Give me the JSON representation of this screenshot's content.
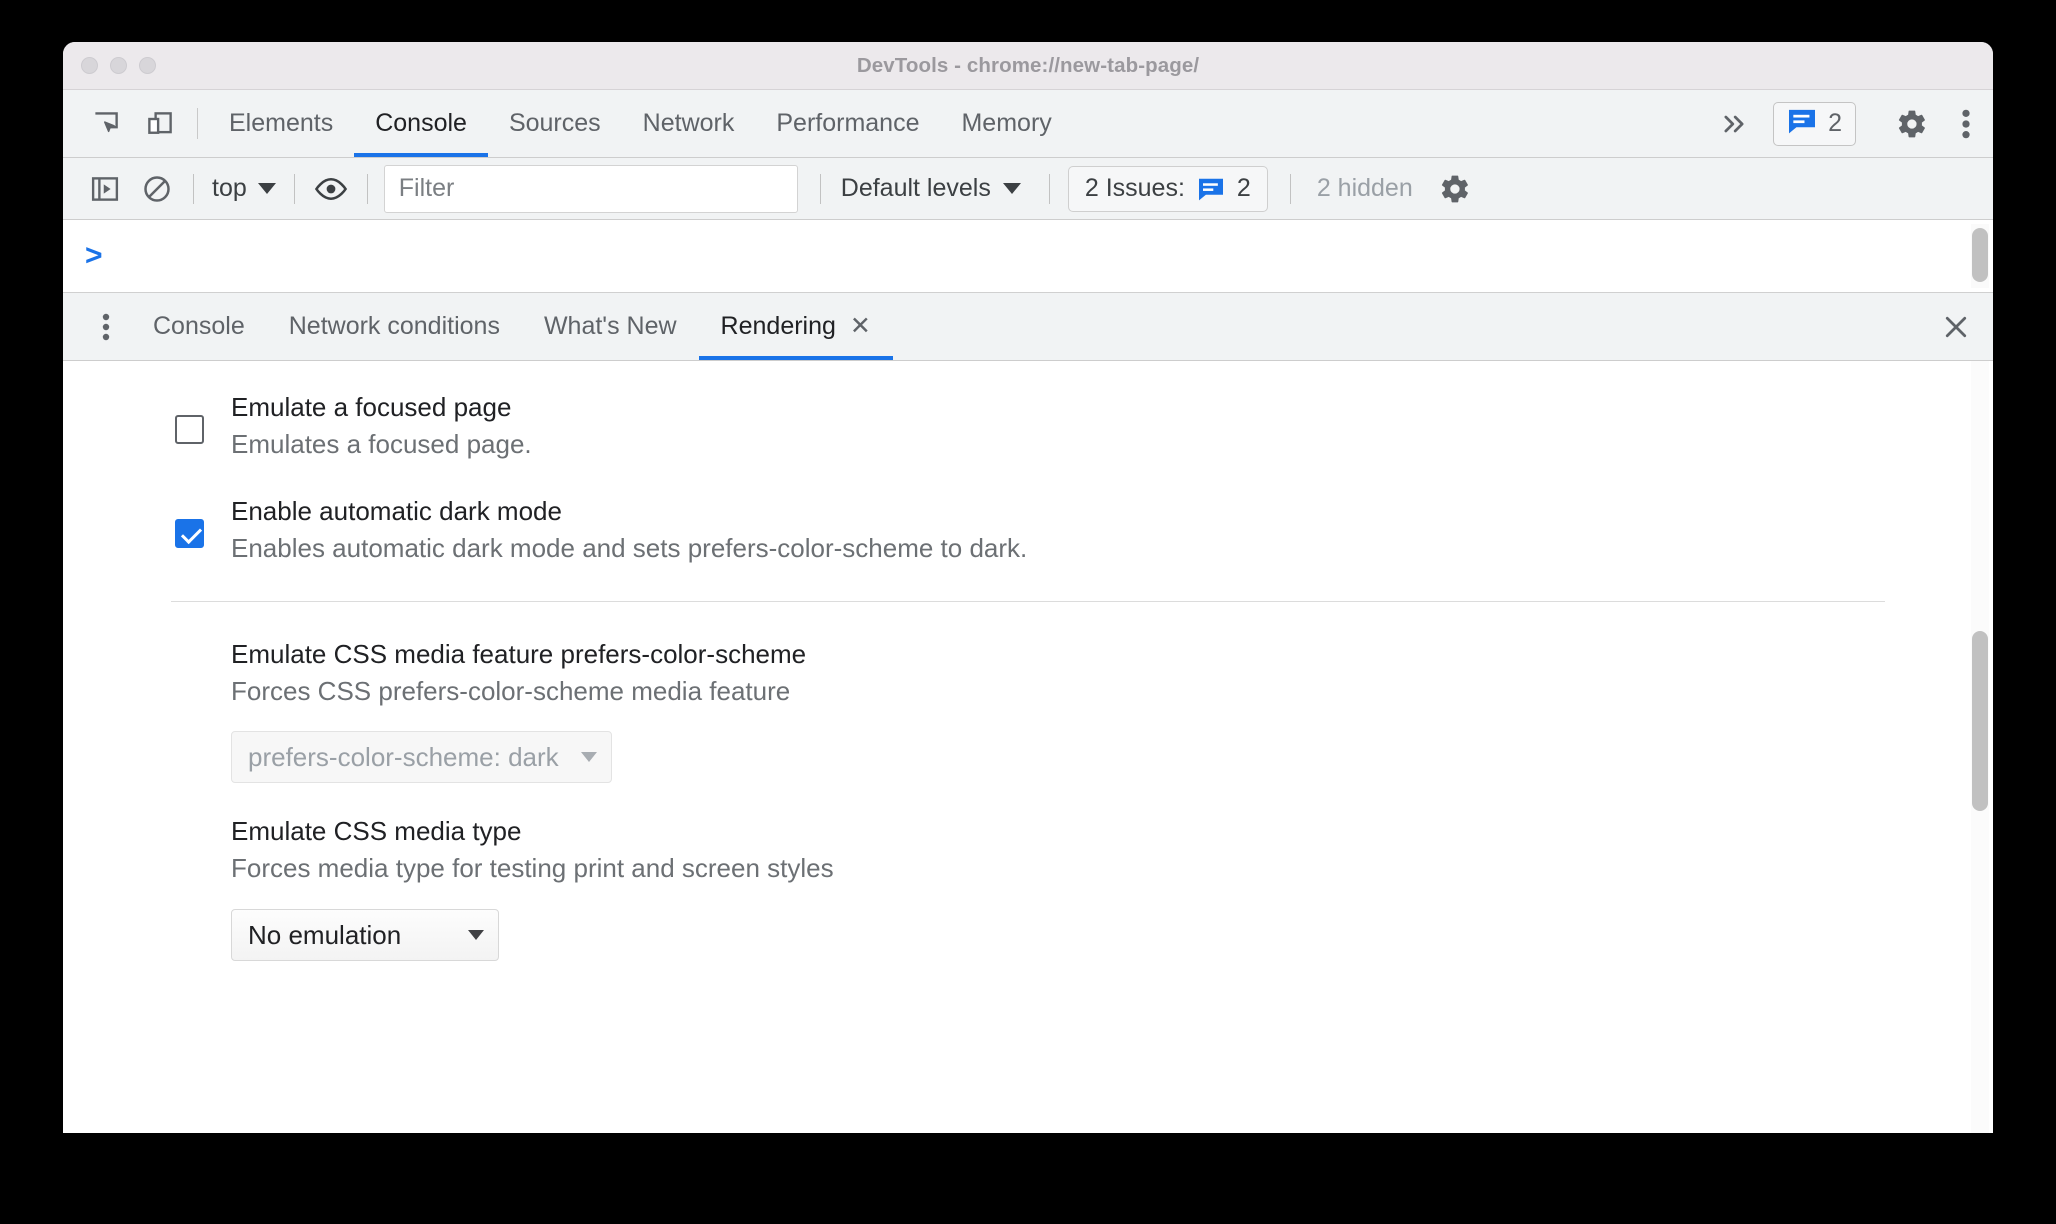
{
  "window": {
    "title": "DevTools - chrome://new-tab-page/",
    "traffic_lights": [
      "close",
      "minimize",
      "zoom"
    ]
  },
  "main_toolbar": {
    "inspect_icon": "inspect-element-icon",
    "device_icon": "device-toolbar-icon",
    "tabs": [
      {
        "label": "Elements",
        "active": false
      },
      {
        "label": "Console",
        "active": true
      },
      {
        "label": "Sources",
        "active": false
      },
      {
        "label": "Network",
        "active": false
      },
      {
        "label": "Performance",
        "active": false
      },
      {
        "label": "Memory",
        "active": false
      }
    ],
    "more_tabs_icon": "chevron-double-right-icon",
    "issues_count": "2",
    "issues_icon": "issue-message-icon",
    "settings_icon": "gear-icon",
    "menu_icon": "three-dots-vertical-icon",
    "accent_color": "#1a73e8"
  },
  "console_toolbar": {
    "sidebar_icon": "console-sidebar-icon",
    "clear_icon": "clear-console-icon",
    "context": "top",
    "eye_icon": "live-expression-eye-icon",
    "filter_placeholder": "Filter",
    "filter_value": "",
    "levels": "Default levels",
    "issues_label": "2 Issues:",
    "issues_badge_icon": "issue-message-icon",
    "issues_badge_count": "2",
    "hidden_label": "2 hidden",
    "settings_icon": "gear-icon"
  },
  "console_output": {
    "prompt": ">"
  },
  "drawer": {
    "more_icon": "three-dots-vertical-icon",
    "tabs": [
      {
        "label": "Console",
        "active": false,
        "closable": false
      },
      {
        "label": "Network conditions",
        "active": false,
        "closable": false
      },
      {
        "label": "What's New",
        "active": false,
        "closable": false
      },
      {
        "label": "Rendering",
        "active": true,
        "closable": true,
        "close_glyph": "✕"
      }
    ],
    "close_glyph": "✕"
  },
  "rendering": {
    "settings": [
      {
        "title": "Emulate a focused page",
        "desc": "Emulates a focused page.",
        "checked": false
      },
      {
        "title": "Enable automatic dark mode",
        "desc": "Enables automatic dark mode and sets prefers-color-scheme to dark.",
        "checked": true
      }
    ],
    "groups": [
      {
        "title": "Emulate CSS media feature prefers-color-scheme",
        "desc": "Forces CSS prefers-color-scheme media feature",
        "select_value": "prefers-color-scheme: dark",
        "disabled": true
      },
      {
        "title": "Emulate CSS media type",
        "desc": "Forces media type for testing print and screen styles",
        "select_value": "No emulation",
        "disabled": false
      }
    ]
  }
}
